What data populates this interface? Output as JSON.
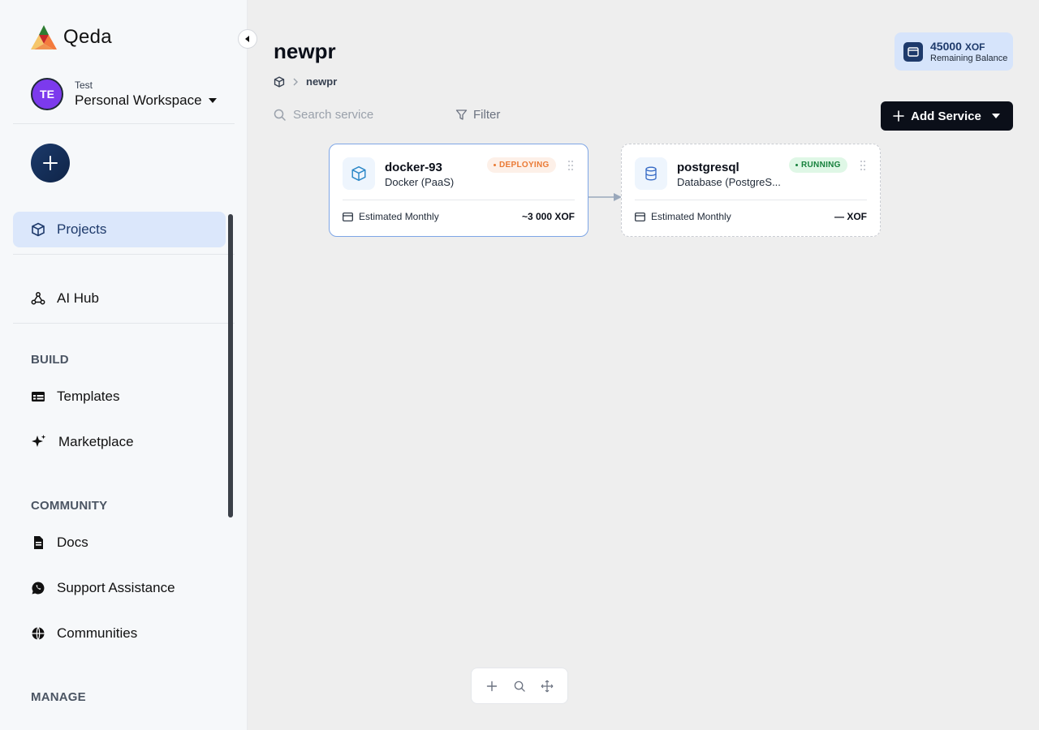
{
  "app": {
    "name": "Qeda"
  },
  "workspace": {
    "avatar_initials": "TE",
    "user": "Test",
    "name": "Personal Workspace"
  },
  "sidebar": {
    "primary": [
      {
        "label": "Projects",
        "icon": "cube-icon",
        "active": true
      },
      {
        "label": "AI Hub",
        "icon": "webhook-icon"
      }
    ],
    "sections": [
      {
        "title": "BUILD",
        "items": [
          {
            "label": "Templates",
            "icon": "table-icon"
          },
          {
            "label": "Marketplace",
            "icon": "sparkle-icon"
          }
        ]
      },
      {
        "title": "COMMUNITY",
        "items": [
          {
            "label": "Docs",
            "icon": "document-icon"
          },
          {
            "label": "Support Assistance",
            "icon": "whatsapp-icon"
          },
          {
            "label": "Communities",
            "icon": "globe-icon"
          }
        ]
      },
      {
        "title": "MANAGE",
        "items": []
      }
    ]
  },
  "page": {
    "title": "newpr",
    "breadcrumb": {
      "current": "newpr"
    }
  },
  "balance": {
    "amount": "45000",
    "currency": "XOF",
    "label": "Remaining Balance"
  },
  "toolbar": {
    "search_placeholder": "Search service",
    "filter_label": "Filter",
    "add_label": "Add Service"
  },
  "services": [
    {
      "name": "docker-93",
      "type": "Docker (PaaS)",
      "status": "DEPLOYING",
      "cost_label": "Estimated Monthly",
      "cost": "~3 000 XOF"
    },
    {
      "name": "postgresql",
      "type": "Database (PostgreS...",
      "status": "RUNNING",
      "cost_label": "Estimated Monthly",
      "cost": "— XOF"
    }
  ],
  "colors": {
    "accent": "#1e3a6b",
    "active_nav_bg": "#dbe7fb",
    "deploying": "#ea7a35",
    "running": "#16803c"
  }
}
